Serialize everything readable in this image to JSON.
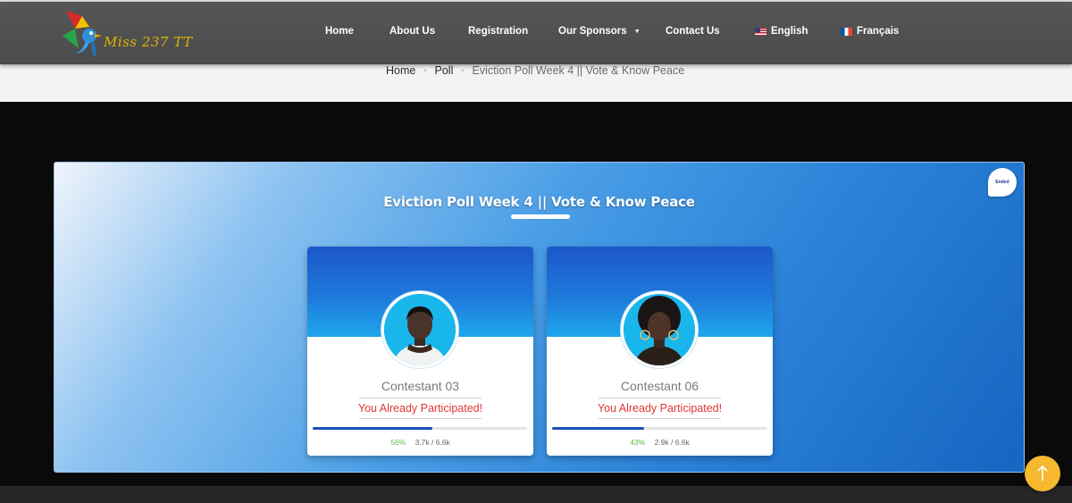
{
  "header": {
    "logo_text": "Miss 237 TT",
    "nav": [
      {
        "label": "Home"
      },
      {
        "label": "About Us"
      },
      {
        "label": "Registration"
      },
      {
        "label": "Our Sponsors"
      },
      {
        "label": "Contact Us"
      },
      {
        "label": "English"
      },
      {
        "label": "Français"
      }
    ]
  },
  "breadcrumb": {
    "items": [
      "Home",
      "Poll"
    ],
    "separator": "•",
    "current": "Eviction Poll Week 4 || Vote & Know Peace"
  },
  "poll": {
    "title": "Eviction Poll Week 4 || Vote & Know Peace",
    "status_badge": "Ended",
    "contestants": [
      {
        "name": "Contestant 03",
        "message": "You Already Participated!",
        "percent": "56%",
        "votes": "3.7k / 6.6k",
        "progress": 0.56
      },
      {
        "name": "Contestant 06",
        "message": "You Already Participated!",
        "percent": "43%",
        "votes": "2.9k / 6.6k",
        "progress": 0.43
      }
    ]
  },
  "colors": {
    "accent": "#1565c2",
    "participated": "#e23636",
    "percent": "#5bbf3a",
    "scroll_button": "#f5b82e"
  },
  "icons": {
    "scroll_top": "arrow-up-icon",
    "sponsors_dropdown": "caret-down-icon",
    "english_flag": "us-flag-icon",
    "french_flag": "fr-flag-icon"
  }
}
